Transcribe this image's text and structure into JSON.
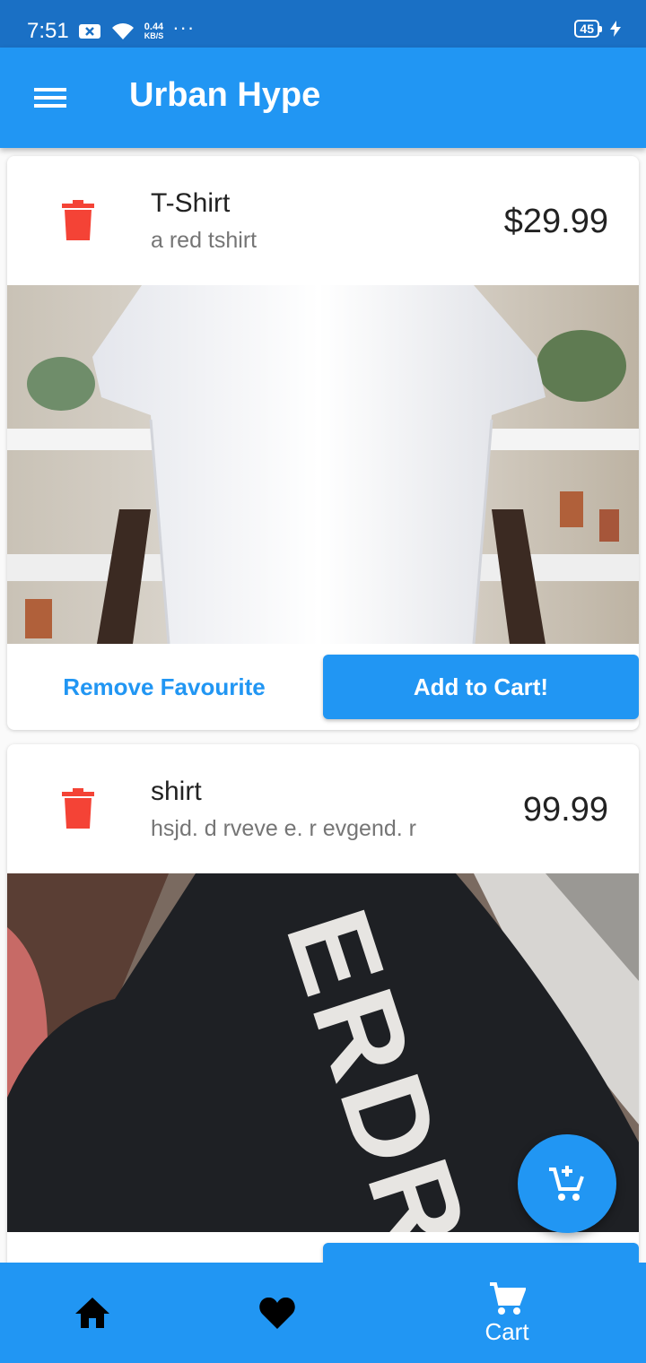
{
  "status_bar": {
    "time": "7:51",
    "net_speed_value": "0.44",
    "net_speed_unit": "KB/S",
    "more": "···",
    "battery": "45"
  },
  "app_bar": {
    "title": "Urban Hype",
    "menu_icon": "menu-icon"
  },
  "favourites": [
    {
      "title": "T-Shirt",
      "subtitle": "a red tshirt",
      "price": "$29.99",
      "remove_label": "Remove Favourite",
      "cart_label": "Add to Cart!"
    },
    {
      "title": "shirt",
      "subtitle": "hsjd. d rveve e. r evgend. r",
      "price": "99.99",
      "image_text": "ERDR"
    }
  ],
  "bottom_nav": {
    "home_icon": "home-icon",
    "fav_icon": "heart-icon",
    "cart_label": "Cart"
  },
  "colors": {
    "primary": "#2196f3",
    "status_bar": "#1a70c5",
    "delete": "#f44336"
  }
}
